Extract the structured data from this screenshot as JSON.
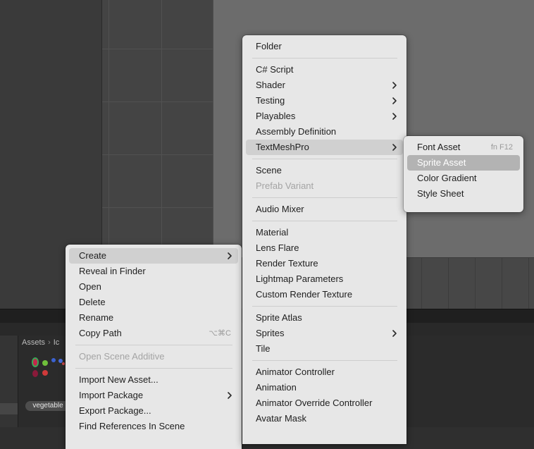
{
  "colors": {
    "menu_bg": "#e7e7e7",
    "menu_highlight": "#d0d0d0",
    "menu_selected": "#b3b3b3",
    "disabled_text": "#a4a4a4",
    "editor_dark": "#3a3a3a",
    "scene_bg": "#6c6c6c"
  },
  "project": {
    "breadcrumb": [
      "Assets",
      "Ic"
    ],
    "asset_label": "vegetable"
  },
  "context_menu": {
    "items": [
      {
        "label": "Create",
        "submenu": true,
        "highlighted": true
      },
      {
        "label": "Reveal in Finder"
      },
      {
        "label": "Open"
      },
      {
        "label": "Delete"
      },
      {
        "label": "Rename"
      },
      {
        "label": "Copy Path",
        "shortcut": "⌥⌘C"
      },
      {
        "separator": true
      },
      {
        "label": "Open Scene Additive",
        "disabled": true
      },
      {
        "separator": true
      },
      {
        "label": "Import New Asset..."
      },
      {
        "label": "Import Package",
        "submenu": true
      },
      {
        "label": "Export Package..."
      },
      {
        "label": "Find References In Scene"
      }
    ]
  },
  "create_menu": {
    "items": [
      {
        "label": "Folder"
      },
      {
        "separator": true
      },
      {
        "label": "C# Script"
      },
      {
        "label": "Shader",
        "submenu": true
      },
      {
        "label": "Testing",
        "submenu": true
      },
      {
        "label": "Playables",
        "submenu": true
      },
      {
        "label": "Assembly Definition"
      },
      {
        "label": "TextMeshPro",
        "submenu": true,
        "highlighted": true
      },
      {
        "separator": true
      },
      {
        "label": "Scene"
      },
      {
        "label": "Prefab Variant",
        "disabled": true
      },
      {
        "separator": true
      },
      {
        "label": "Audio Mixer"
      },
      {
        "separator": true
      },
      {
        "label": "Material"
      },
      {
        "label": "Lens Flare"
      },
      {
        "label": "Render Texture"
      },
      {
        "label": "Lightmap Parameters"
      },
      {
        "label": "Custom Render Texture"
      },
      {
        "separator": true
      },
      {
        "label": "Sprite Atlas"
      },
      {
        "label": "Sprites",
        "submenu": true
      },
      {
        "label": "Tile"
      },
      {
        "separator": true
      },
      {
        "label": "Animator Controller"
      },
      {
        "label": "Animation"
      },
      {
        "label": "Animator Override Controller"
      },
      {
        "label": "Avatar Mask"
      }
    ]
  },
  "textmeshpro_menu": {
    "items": [
      {
        "label": "Font Asset",
        "shortcut": "fn F12"
      },
      {
        "label": "Sprite Asset",
        "selected": true
      },
      {
        "label": "Color Gradient"
      },
      {
        "label": "Style Sheet"
      }
    ]
  }
}
